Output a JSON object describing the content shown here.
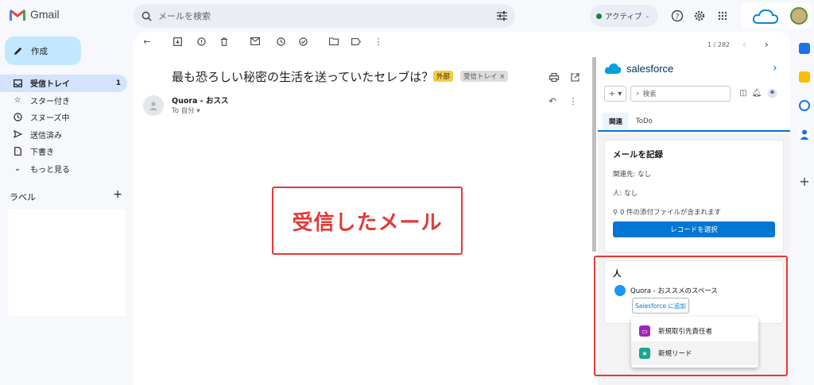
{
  "app": {
    "name": "Gmail"
  },
  "search": {
    "placeholder": "メールを検索"
  },
  "status": {
    "label": "アクティブ"
  },
  "compose": {
    "label": "作成"
  },
  "nav": {
    "items": [
      {
        "label": "受信トレイ",
        "count": "1",
        "icon": "inbox-icon"
      },
      {
        "label": "スター付き",
        "icon": "star-icon"
      },
      {
        "label": "スヌーズ中",
        "icon": "clock-icon"
      },
      {
        "label": "送信済み",
        "icon": "send-icon"
      },
      {
        "label": "下書き",
        "icon": "draft-icon"
      },
      {
        "label": "もっと見る",
        "icon": "chevron-down-icon"
      }
    ],
    "labels_heading": "ラベル",
    "labels_add": "+"
  },
  "message": {
    "pager": "1 / 282",
    "subject": "最も恐ろしい秘密の生活を送っていたセレブは？",
    "tag_external": "外部",
    "tag_inbox": "受信トレイ ×",
    "sender": "Quora - おスス",
    "to": "To 自分 ▾"
  },
  "annotation": {
    "mail_label": "受信したメール"
  },
  "salesforce": {
    "brand": "salesforce",
    "add_label": "+ ▾",
    "search_placeholder": "検索",
    "tabs": [
      "関連",
      "ToDo"
    ],
    "log_card": {
      "title": "メールを記録",
      "related": "関連先: なし",
      "person": "人: なし",
      "attachments": "0 件の添付ファイルが含まれます",
      "button": "レコードを選択"
    },
    "people_card": {
      "title": "人",
      "name": "Quora - おススメのスペース",
      "add_button": "Salesforce に追加"
    },
    "dropdown": [
      {
        "label": "新規取引先責任者",
        "color": "#9c27b0"
      },
      {
        "label": "新規リード",
        "color": "#1aa58c"
      }
    ]
  },
  "colors": {
    "accent": "#0176d3",
    "annotation": "#e53935",
    "compose_bg": "#c2e7ff"
  }
}
